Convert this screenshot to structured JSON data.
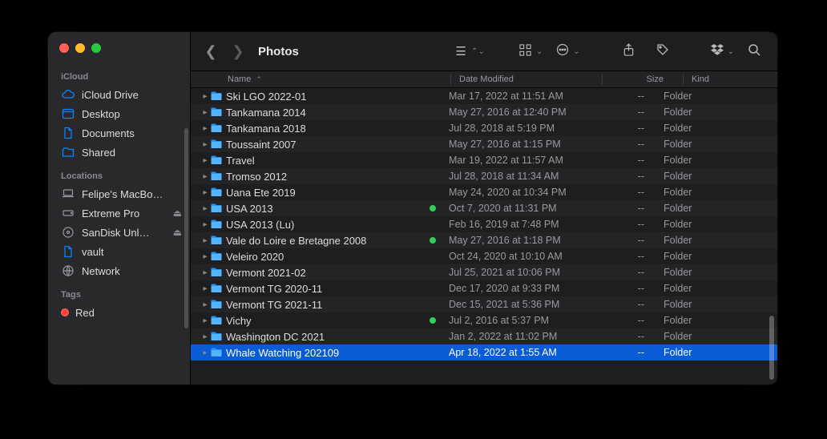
{
  "window_title": "Photos",
  "sidebar": {
    "sections": [
      {
        "label": "iCloud",
        "items": [
          {
            "icon": "cloud",
            "label": "iCloud Drive"
          },
          {
            "icon": "desktop",
            "label": "Desktop"
          },
          {
            "icon": "doc",
            "label": "Documents"
          },
          {
            "icon": "shared",
            "label": "Shared"
          }
        ]
      },
      {
        "label": "Locations",
        "items": [
          {
            "icon": "laptop",
            "label": "Felipe's MacBo…"
          },
          {
            "icon": "drive",
            "label": "Extreme Pro",
            "eject": true
          },
          {
            "icon": "disc",
            "label": "SanDisk Unl…",
            "eject": true
          },
          {
            "icon": "doc",
            "label": "vault"
          },
          {
            "icon": "globe",
            "label": "Network"
          }
        ]
      },
      {
        "label": "Tags",
        "items": [
          {
            "icon": "tag",
            "label": "Red",
            "color": "#ff453a"
          }
        ]
      }
    ]
  },
  "columns": {
    "name": "Name",
    "date": "Date Modified",
    "size": "Size",
    "kind": "Kind"
  },
  "rows": [
    {
      "name": "Ski LGO 2022-01",
      "date": "Mar 17, 2022 at 11:51 AM",
      "size": "--",
      "kind": "Folder",
      "partial": true
    },
    {
      "name": "Tankamana 2014",
      "date": "May 27, 2016 at 12:40 PM",
      "size": "--",
      "kind": "Folder"
    },
    {
      "name": "Tankamana 2018",
      "date": "Jul 28, 2018 at 5:19 PM",
      "size": "--",
      "kind": "Folder"
    },
    {
      "name": "Toussaint 2007",
      "date": "May 27, 2016 at 1:15 PM",
      "size": "--",
      "kind": "Folder"
    },
    {
      "name": "Travel",
      "date": "Mar 19, 2022 at 11:57 AM",
      "size": "--",
      "kind": "Folder"
    },
    {
      "name": "Tromso 2012",
      "date": "Jul 28, 2018 at 11:34 AM",
      "size": "--",
      "kind": "Folder"
    },
    {
      "name": "Uana Ete 2019",
      "date": "May 24, 2020 at 10:34 PM",
      "size": "--",
      "kind": "Folder"
    },
    {
      "name": "USA 2013",
      "date": "Oct 7, 2020 at 11:31 PM",
      "size": "--",
      "kind": "Folder",
      "tag": "#30d158"
    },
    {
      "name": "USA 2013 (Lu)",
      "date": "Feb 16, 2019 at 7:48 PM",
      "size": "--",
      "kind": "Folder"
    },
    {
      "name": "Vale do Loire e Bretagne 2008",
      "date": "May 27, 2016 at 1:18 PM",
      "size": "--",
      "kind": "Folder",
      "tag": "#30d158"
    },
    {
      "name": "Veleiro 2020",
      "date": "Oct 24, 2020 at 10:10 AM",
      "size": "--",
      "kind": "Folder"
    },
    {
      "name": "Vermont 2021-02",
      "date": "Jul 25, 2021 at 10:06 PM",
      "size": "--",
      "kind": "Folder"
    },
    {
      "name": "Vermont TG 2020-11",
      "date": "Dec 17, 2020 at 9:33 PM",
      "size": "--",
      "kind": "Folder"
    },
    {
      "name": "Vermont TG 2021-11",
      "date": "Dec 15, 2021 at 5:36 PM",
      "size": "--",
      "kind": "Folder"
    },
    {
      "name": "Vichy",
      "date": "Jul 2, 2016 at 5:37 PM",
      "size": "--",
      "kind": "Folder",
      "tag": "#30d158"
    },
    {
      "name": "Washington DC 2021",
      "date": "Jan 2, 2022 at 11:02 PM",
      "size": "--",
      "kind": "Folder"
    },
    {
      "name": "Whale Watching 202109",
      "date": "Apr 18, 2022 at 1:55 AM",
      "size": "--",
      "kind": "Folder",
      "selected": true
    }
  ]
}
